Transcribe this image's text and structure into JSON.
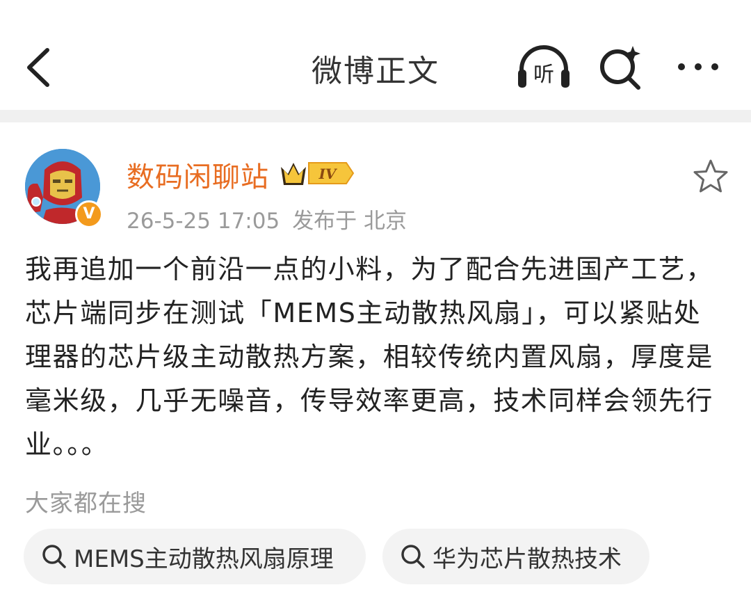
{
  "nav": {
    "title": "微博正文",
    "back_icon": "chevron-left-icon",
    "listen_label": "听",
    "search_icon": "search-sparkle-icon",
    "more_icon": "more-dots-icon"
  },
  "post": {
    "username": "数码闲聊站",
    "member_level": "IV",
    "verify_mark": "V",
    "timestamp": "26-5-25 17:05",
    "location": "发布于 北京",
    "body": "我再追加一个前沿一点的小料，为了配合先进国产工艺，芯片端同步在测试「MEMS主动散热风扇」，可以紧贴处理器的芯片级主动散热方案，相较传统内置风扇，厚度是毫米级，几乎无噪音，传导效率更高，技术同样会领先行业。。。"
  },
  "related_search": {
    "heading": "大家都在搜",
    "chips": [
      {
        "label": "MEMS主动散热风扇原理"
      },
      {
        "label": "华为芯片散热技术"
      }
    ]
  },
  "colors": {
    "username": "#e86d22",
    "verify_badge": "#f39a1c",
    "meta_text": "#9a9a9a",
    "chip_bg": "#f3f3f3",
    "divider": "#f0f0f0"
  }
}
